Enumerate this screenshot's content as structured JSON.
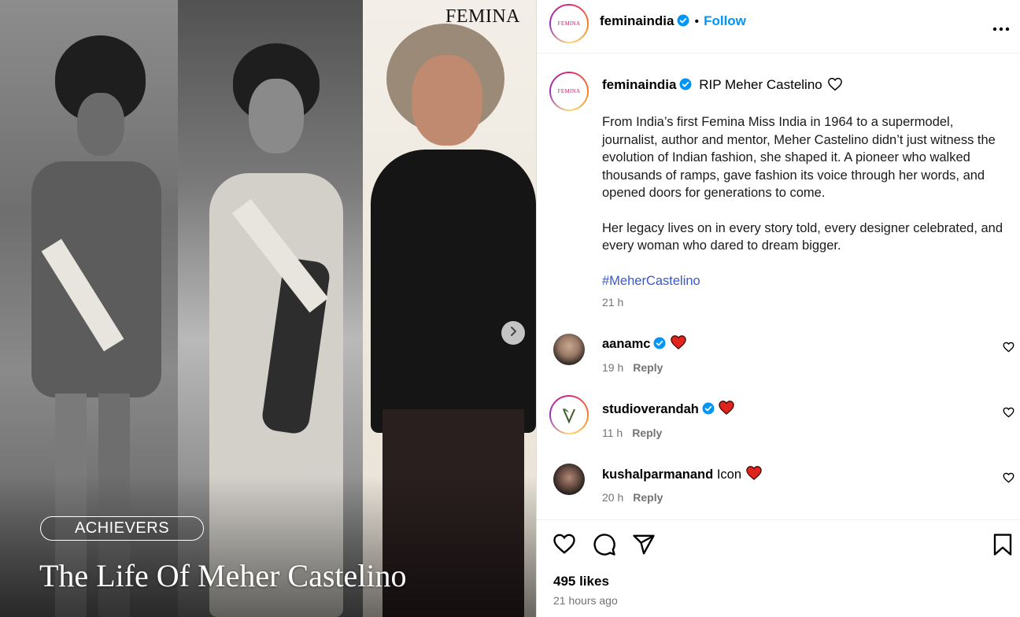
{
  "media": {
    "logo": "FEMINA",
    "badge": "ACHIEVERS",
    "title": "The Life Of Meher Castelino"
  },
  "header": {
    "username": "feminaindia",
    "separator": "•",
    "follow_label": "Follow",
    "more_label": "•••",
    "avatar_text": "FEMINA"
  },
  "caption": {
    "username": "feminaindia",
    "title": "RIP Meher Castelino",
    "paragraph1": "From India’s first Femina Miss India in 1964 to a supermodel, journalist, author and mentor, Meher Castelino didn’t just witness the evolution of Indian fashion, she shaped it. A pioneer who walked thousands of ramps, gave fashion its voice through her words, and opened doors for generations to come.",
    "paragraph2": "Her legacy lives on in every story told, every designer celebrated, and every woman who dared to dream bigger.",
    "hashtag": "#MeherCastelino",
    "time": "21 h"
  },
  "comments": [
    {
      "username": "aanamc",
      "text": "",
      "time": "19 h",
      "reply": "Reply"
    },
    {
      "username": "studioverandah",
      "text": "",
      "time": "11 h",
      "reply": "Reply"
    },
    {
      "username": "kushalparmanand",
      "text": "Icon",
      "time": "20 h",
      "reply": "Reply"
    }
  ],
  "footer": {
    "likes": "495 likes",
    "ago": "21 hours ago"
  },
  "colors": {
    "follow": "#0095f6",
    "verified": "#0095f6",
    "heart_red": "#e0241c",
    "hashtag": "#3a58c9",
    "muted": "#737373"
  },
  "icons": [
    "more-icon",
    "heart-icon",
    "comment-icon",
    "share-icon",
    "save-icon",
    "verified-icon",
    "chevron-right-icon"
  ]
}
